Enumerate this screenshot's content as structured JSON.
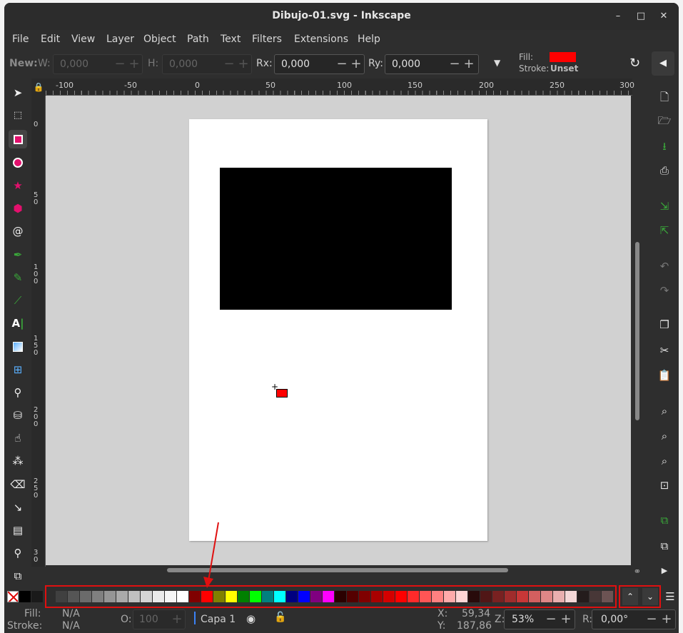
{
  "window": {
    "title": "Dibujo-01.svg - Inkscape",
    "controls": [
      "–",
      "□",
      "✕"
    ]
  },
  "menu": [
    "File",
    "Edit",
    "View",
    "Layer",
    "Object",
    "Path",
    "Text",
    "Filters",
    "Extensions",
    "Help"
  ],
  "toolctrl": {
    "new_label": "New:",
    "w_label": "W:",
    "w_value": "0,000",
    "h_label": "H:",
    "h_value": "0,000",
    "rx_label": "Rx:",
    "rx_value": "0,000",
    "ry_label": "Ry:",
    "ry_value": "0,000",
    "fill_label": "Fill:",
    "fill_color": "#ff0000",
    "stroke_label": "Stroke:",
    "stroke_value": "Unset"
  },
  "ruler": {
    "h_ticks": [
      "-100",
      "-50",
      "0",
      "50",
      "100",
      "150",
      "200",
      "250",
      "300"
    ],
    "v_ticks": [
      "0",
      "5\n0",
      "1\n0\n0",
      "1\n5\n0",
      "2\n0\n0",
      "2\n5\n0",
      "3\n0"
    ]
  },
  "palette": {
    "colors": [
      "#404040",
      "#555555",
      "#6b6b6b",
      "#808080",
      "#959595",
      "#aaaaaa",
      "#c0c0c0",
      "#d5d5d5",
      "#eaeaea",
      "#f5f5f5",
      "#ffffff",
      "#800000",
      "#ff0000",
      "#808000",
      "#ffff00",
      "#008000",
      "#00ff00",
      "#008080",
      "#00ffff",
      "#000080",
      "#0000ff",
      "#800080",
      "#ff00ff",
      "#2b0000",
      "#550000",
      "#800000",
      "#aa0000",
      "#d40000",
      "#ff0000",
      "#ff2a2a",
      "#ff5555",
      "#ff8080",
      "#ffaaaa",
      "#ffd5d5",
      "#280b0b",
      "#501616",
      "#782121",
      "#a02c2c",
      "#c83737",
      "#d35f5f",
      "#de8787",
      "#e9afaf",
      "#f4d7d7",
      "#241c1c",
      "#483737",
      "#6c5353"
    ]
  },
  "status": {
    "fill_label": "Fill:",
    "fill_value": "N/A",
    "stroke_label": "Stroke:",
    "stroke_value": "N/A",
    "opacity_label": "O:",
    "opacity_value": "100",
    "layer_name": "Capa 1",
    "x_label": "X:",
    "x_value": "59,34",
    "y_label": "Y:",
    "y_value": "187,86",
    "zoom_label": "Z:",
    "zoom_value": "53%",
    "rotation_label": "R:",
    "rotation_value": "0,00°"
  }
}
